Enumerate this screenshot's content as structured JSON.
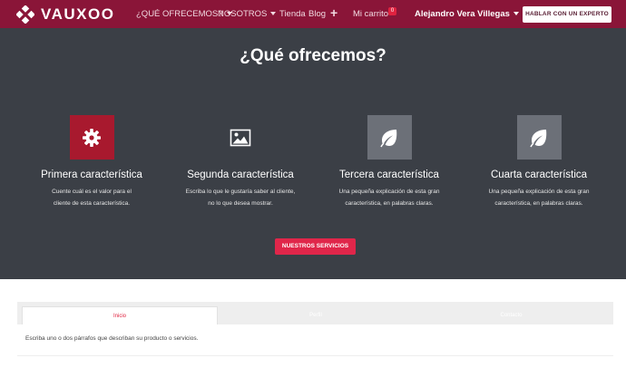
{
  "navbar": {
    "logo_text": "VAUXOO",
    "items": [
      {
        "label": "¿QUÉ OFRECEMOS?"
      },
      {
        "label": "NOSOTROS"
      },
      {
        "label": "Tienda"
      },
      {
        "label": "Blog"
      }
    ],
    "plus": "+",
    "cart_label": "Mi carrito",
    "cart_count": "0",
    "user_name": "Alejandro Vera Villegas",
    "expert_button": "HABLAR CON UN EXPERTO"
  },
  "hero": {
    "title": "¿Qué ofrecemos?",
    "features": [
      {
        "title": "Primera característica",
        "desc1": "Cuente cuál es el valor para el",
        "desc2": "cliente de esta característica.",
        "icon": "gear-icon"
      },
      {
        "title": "Segunda característica",
        "desc1": "Escriba lo que le gustaría saber al cliente,",
        "desc2": "no lo que desea mostrar.",
        "icon": "image-icon"
      },
      {
        "title": "Tercera característica",
        "desc1": "Una pequeña explicación de esta gran",
        "desc2": "característica, en palabras claras.",
        "icon": "leaf-icon"
      },
      {
        "title": "Cuarta característica",
        "desc1": "Una pequeña explicación de esta gran",
        "desc2": "característica, en palabras claras.",
        "icon": "leaf-icon"
      }
    ],
    "services_button": "NUESTROS SERVICIOS"
  },
  "tabs": {
    "items": [
      {
        "label": "Inicio"
      },
      {
        "label": "Perfil"
      },
      {
        "label": "Contacto"
      }
    ],
    "content": "Escriba uno o dos párrafos que describan su producto o servicios."
  },
  "colors": {
    "brand": "#8a1538",
    "hero_bg": "#3b3f46",
    "accent": "#e0264a"
  }
}
